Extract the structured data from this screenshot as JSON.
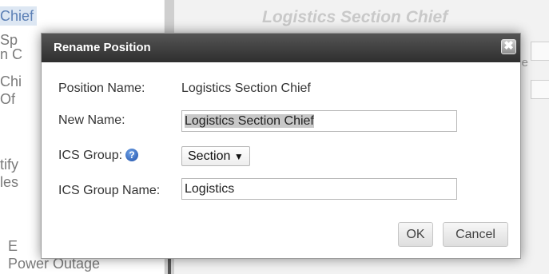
{
  "background": {
    "left_list": {
      "selected_item": "Chief",
      "items": [
        "Sp",
        "n C",
        "Chi",
        "Of",
        "tify",
        "les",
        "E",
        "Power Outage"
      ]
    },
    "panel_title": "Logistics Section Chief",
    "close_text": "close"
  },
  "dialog": {
    "title": "Rename Position",
    "close_symbol": "✖",
    "fields": {
      "position_name_label": "Position Name:",
      "position_name_value": "Logistics Section Chief",
      "new_name_label": "New Name:",
      "new_name_value": "Logistics Section Chief",
      "ics_group_label": "ICS Group:",
      "ics_group_help_symbol": "?",
      "ics_group_value": "Section",
      "ics_group_arrow": "▼",
      "ics_group_name_label": "ICS Group Name:",
      "ics_group_name_value": "Logistics"
    },
    "buttons": {
      "ok": "OK",
      "cancel": "Cancel"
    }
  },
  "colors": {
    "titlebar": "#3a3a3a",
    "help_icon": "#1f4fa8",
    "selected_item_bg": "#dde7f3"
  },
  "icons": {
    "close": "close-icon",
    "help": "help-icon",
    "dropdown": "chevron-down-icon"
  }
}
